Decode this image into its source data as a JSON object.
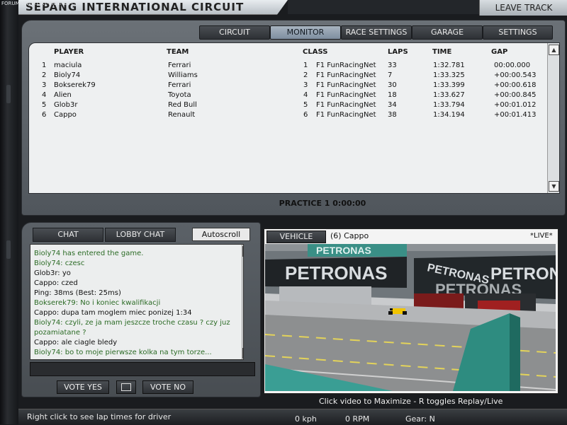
{
  "header": {
    "title": "SEPANG INTERNATIONAL CIRCUIT",
    "leave_track": "LEAVE TRACK",
    "watermark": "FORUM WWW.GRY-ONLINE.PL"
  },
  "tabs": [
    {
      "label": "CIRCUIT",
      "active": false
    },
    {
      "label": "MONITOR",
      "active": true
    },
    {
      "label": "RACE SETTINGS",
      "active": false
    },
    {
      "label": "GARAGE",
      "active": false
    },
    {
      "label": "SETTINGS",
      "active": false
    }
  ],
  "standings": {
    "columns": [
      "PLAYER",
      "TEAM",
      "CLASS",
      "LAPS",
      "TIME",
      "GAP"
    ],
    "rows": [
      {
        "pos": "1",
        "player": "maciula",
        "team": "Ferrari",
        "class_no": "1",
        "class": "F1 FunRacingNet",
        "laps": "33",
        "time": "1:32.781",
        "gap": "00:00.000"
      },
      {
        "pos": "2",
        "player": "Bioly74",
        "team": "Williams",
        "class_no": "2",
        "class": "F1 FunRacingNet",
        "laps": "7",
        "time": "1:33.325",
        "gap": "+00:00.543"
      },
      {
        "pos": "3",
        "player": "Bokserek79",
        "team": "Ferrari",
        "class_no": "3",
        "class": "F1 FunRacingNet",
        "laps": "30",
        "time": "1:33.399",
        "gap": "+00:00.618"
      },
      {
        "pos": "4",
        "player": "Alien",
        "team": "Toyota",
        "class_no": "4",
        "class": "F1 FunRacingNet",
        "laps": "18",
        "time": "1:33.627",
        "gap": "+00:00.845"
      },
      {
        "pos": "5",
        "player": "Glob3r",
        "team": "Red Bull",
        "class_no": "5",
        "class": "F1 FunRacingNet",
        "laps": "34",
        "time": "1:33.794",
        "gap": "+00:01.012"
      },
      {
        "pos": "6",
        "player": "Cappo",
        "team": "Renault",
        "class_no": "6",
        "class": "F1 FunRacingNet",
        "laps": "38",
        "time": "1:34.194",
        "gap": "+00:01.413"
      }
    ]
  },
  "session": {
    "status": "PRACTICE 1   0:00:00"
  },
  "chat": {
    "tabs": [
      "CHAT",
      "LOBBY CHAT"
    ],
    "autoscroll": "Autoscroll",
    "messages": [
      {
        "text": "Bioly74 has entered the game.",
        "color": "#2b6b25"
      },
      {
        "text": "Bioly74: czesc",
        "color": "#2b6b25"
      },
      {
        "text": "Glob3r: yo",
        "color": "#111111"
      },
      {
        "text": "Cappo: czed",
        "color": "#111111"
      },
      {
        "text": "Ping: 38ms (Best: 25ms)",
        "color": "#111111"
      },
      {
        "text": "Bokserek79: No i koniec kwalifikacji",
        "color": "#2b6b25"
      },
      {
        "text": "Cappo: dupa tam moglem miec ponizej 1:34",
        "color": "#111111"
      },
      {
        "text": "Bioly74: czyli, ze ja mam jeszcze troche czasu ? czy juz",
        "color": "#2b6b25"
      },
      {
        "text": "pozamiatane ?",
        "color": "#2b6b25"
      },
      {
        "text": "Cappo: ale ciagle bledy",
        "color": "#111111"
      },
      {
        "text": "Bioly74: bo to moje pierwsze kolka na tym torze...",
        "color": "#2b6b25"
      }
    ],
    "vote_yes": "VOTE YES",
    "vote_no": "VOTE NO"
  },
  "video": {
    "vehicle_button": "VEHICLE",
    "vehicle_name": "(6) Cappo",
    "live": "*LIVE*",
    "sign_text": "PETRONAS",
    "hint": "Click video to Maximize  -  R toggles Replay/Live"
  },
  "status_bar": {
    "hint": "Right click to see lap times for driver",
    "speed": "0 kph",
    "rpm": "0 RPM",
    "gear": "Gear: N"
  },
  "colors": {
    "accent_tab": "#8e9cab",
    "chat_green": "#2b6b25",
    "panel_gray": "#5e646a"
  }
}
